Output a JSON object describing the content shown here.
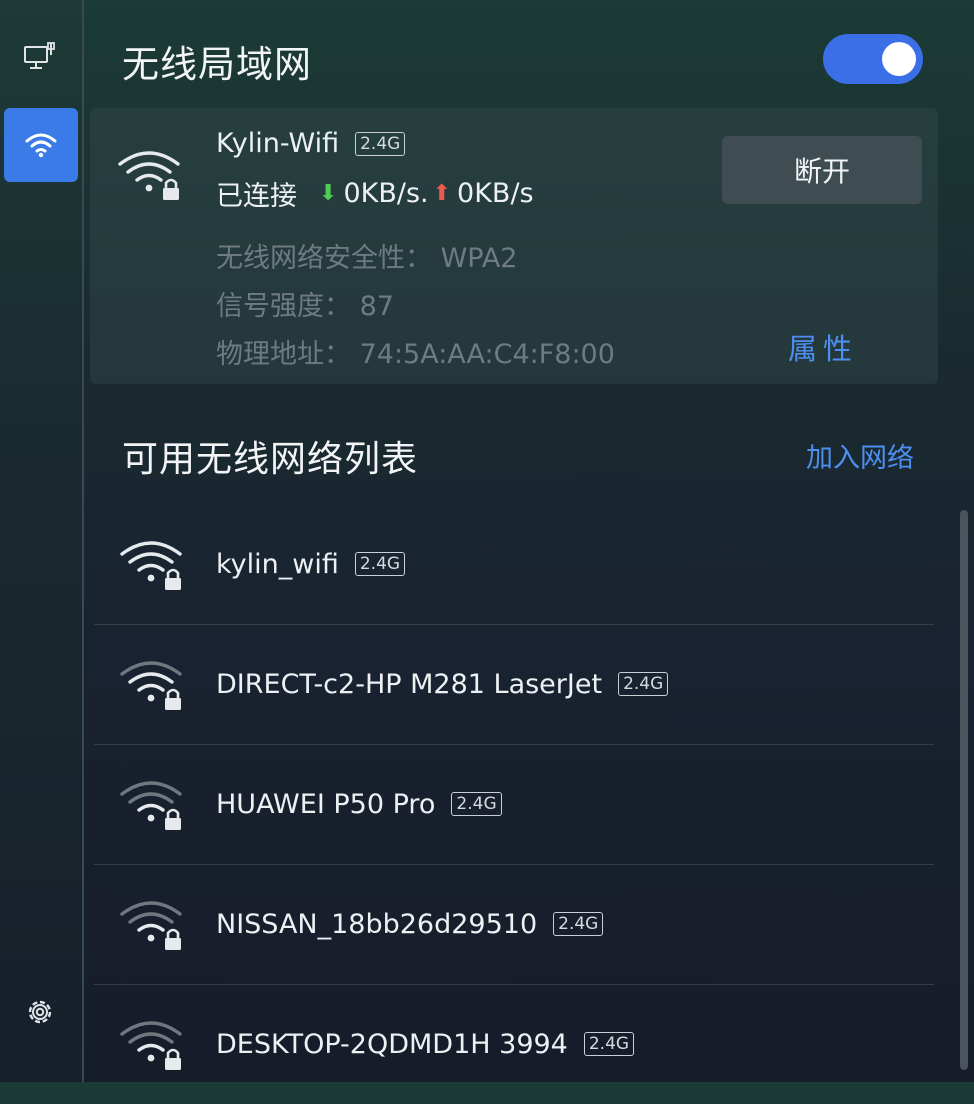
{
  "sidebar": {
    "items": [
      {
        "icon": "wired-network-icon"
      },
      {
        "icon": "wifi-icon",
        "active": true
      },
      {
        "icon": "gear-icon"
      }
    ]
  },
  "header": {
    "title": "无线局域网",
    "toggle_on": true
  },
  "connected": {
    "name": "Kylin-Wifi",
    "band": "2.4G",
    "status": "已连接",
    "down_speed": "0KB/s.",
    "up_speed": "0KB/s",
    "security": "无线网络安全性：  WPA2",
    "signal": "信号强度：  87",
    "mac": "物理地址：  74:5A:AA:C4:F8:00",
    "disconnect_label": "断开",
    "properties_label": "属性"
  },
  "list": {
    "title": "可用无线网络列表",
    "join_label": "加入网络",
    "networks": [
      {
        "name": "kylin_wifi",
        "band": "2.4G",
        "signal": "strong"
      },
      {
        "name": "DIRECT-c2-HP M281 LaserJet",
        "band": "2.4G",
        "signal": "weak"
      },
      {
        "name": "HUAWEI P50 Pro",
        "band": "2.4G",
        "signal": "weak"
      },
      {
        "name": "NISSAN_18bb26d29510",
        "band": "2.4G",
        "signal": "weak"
      },
      {
        "name": "DESKTOP-2QDMD1H 3994",
        "band": "2.4G",
        "signal": "weak"
      }
    ]
  },
  "colors": {
    "accent": "#3b7be8",
    "link": "#4d8ff0",
    "download": "#4fcc52",
    "upload": "#ec5a4c"
  }
}
